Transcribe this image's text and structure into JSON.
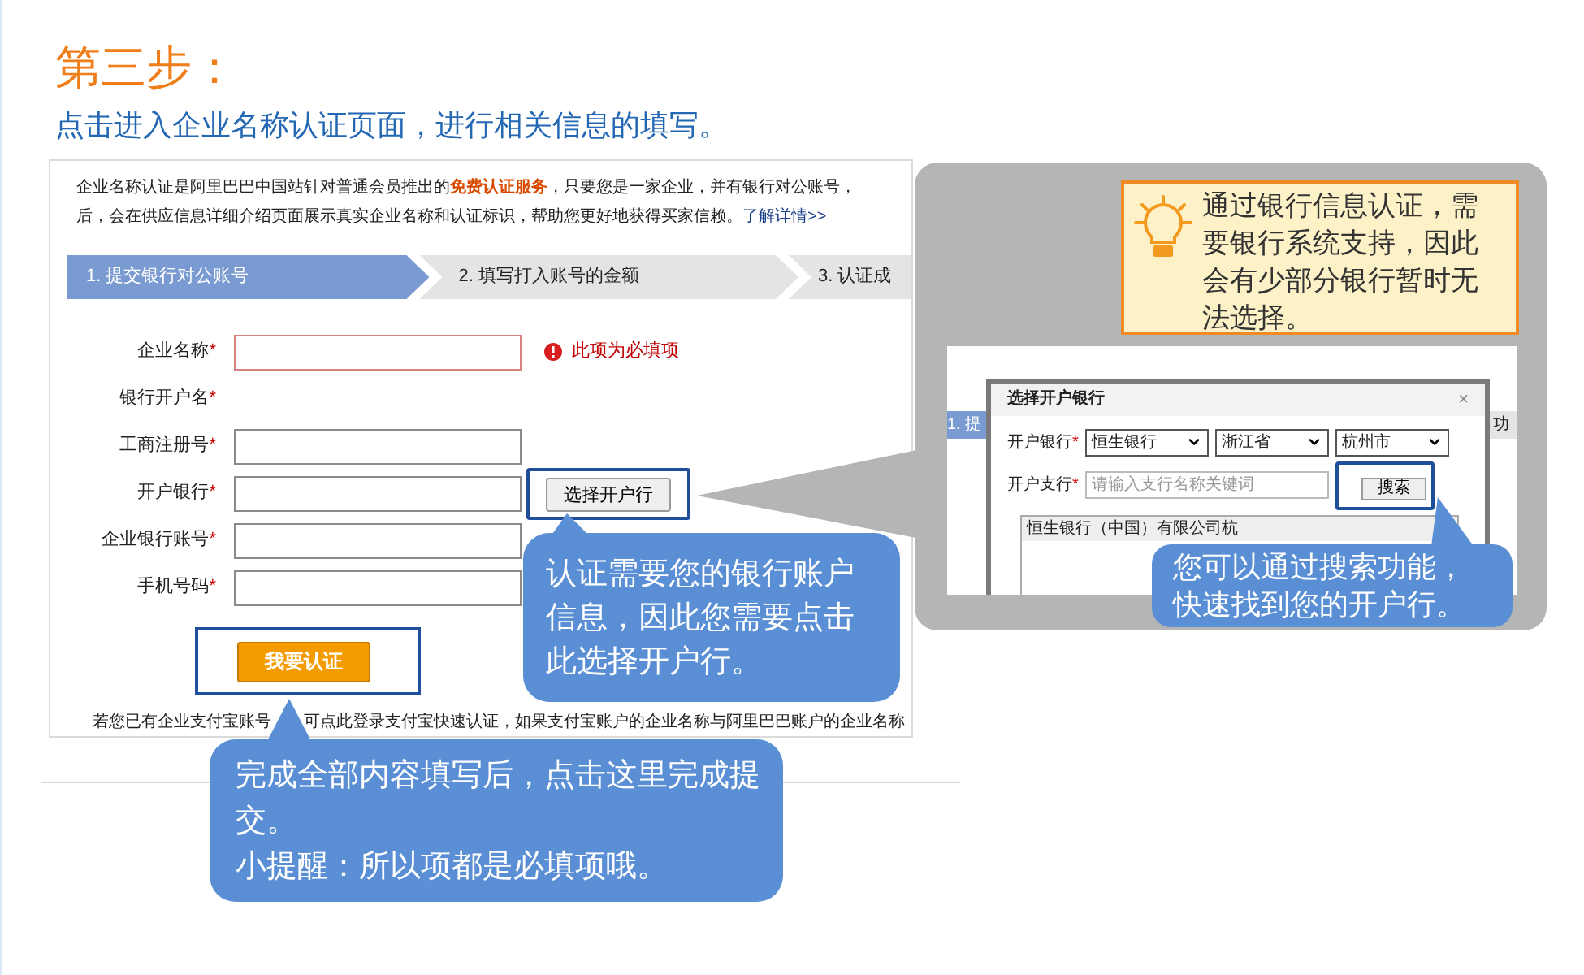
{
  "heading": {
    "title": "第三步：",
    "subtitle": "点击进入企业名称认证页面，进行相关信息的填写。"
  },
  "form_page": {
    "intro_before": "企业名称认证是阿里巴巴中国站针对普通会员推出的",
    "intro_highlight": "免费认证服务",
    "intro_after": "，只要您是一家企业，并有银行对公账号，",
    "intro_line2": "后，会在供应信息详细介绍页面展示真实企业名称和认证标识，帮助您更好地获得买家信赖。",
    "intro_link": "了解详情>>",
    "steps": [
      {
        "label": "1. 提交银行对公账号",
        "selected": true
      },
      {
        "label": "2. 填写打入账号的金额",
        "selected": false
      },
      {
        "label": "3. 认证成",
        "selected": false
      }
    ],
    "fields": [
      {
        "label": "企业名称",
        "mark": "*",
        "kind": "input",
        "error": "此项为必填项"
      },
      {
        "label": "银行开户名",
        "mark": "*",
        "kind": "text"
      },
      {
        "label": "工商注册号",
        "mark": "*",
        "kind": "input"
      },
      {
        "label": "开户银行",
        "mark": "*",
        "kind": "input_button",
        "button": "选择开户行"
      },
      {
        "label": "企业银行账号",
        "mark": "*",
        "kind": "input"
      },
      {
        "label": "手机号码",
        "mark": "*",
        "kind": "input"
      }
    ],
    "submit": "我要认证",
    "footer_before": "若您已有企业支付宝账号",
    "footer_after": "可点此登录支付宝快速认证，如果支付宝账户的企业名称与阿里巴巴账户的企业名称"
  },
  "bank_callout": "认证需要您的银行账户信息，因此您需要点击此选择开户行。",
  "submit_callout": [
    "完成全部内容填写后，点击这里完成提交。",
    "小提醒：所以项都是必填项哦。"
  ],
  "tip": "通过银行信息认证，需要银行系统支持，因此会有少部分银行暂时无法选择。",
  "dialog_screenshot": {
    "step_fragment": "1. 提",
    "right_fragment": "功",
    "title": "选择开户银行",
    "close": "×",
    "bank_label": "开户银行",
    "bank_mark": "*",
    "selects": [
      "恒生银行",
      "浙江省",
      "杭州市"
    ],
    "branch_label": "开户支行",
    "branch_mark": "*",
    "branch_placeholder": "请输入支行名称关键词",
    "search": "搜索",
    "list_header": "恒生银行（中国）有限公司杭"
  },
  "search_callout": [
    "您可以通过搜索功能，",
    "快速找到您的开户行。"
  ]
}
